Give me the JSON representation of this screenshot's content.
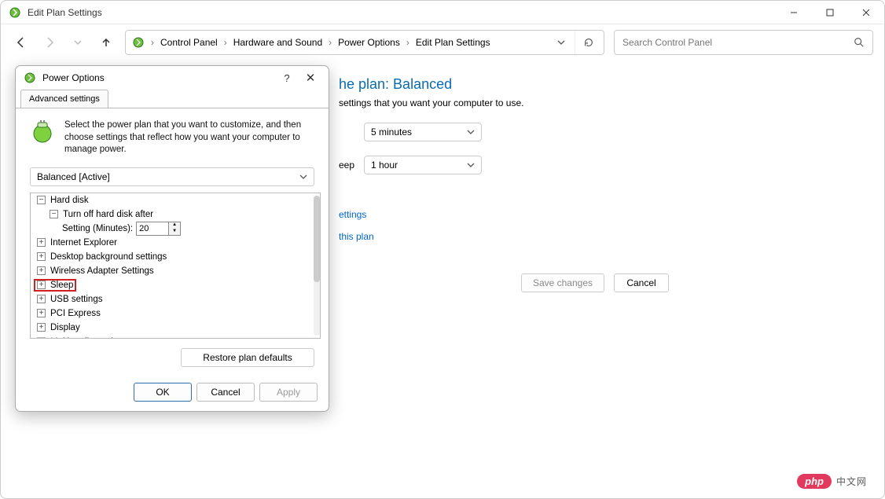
{
  "window": {
    "title": "Edit Plan Settings"
  },
  "breadcrumb": {
    "items": [
      "Control Panel",
      "Hardware and Sound",
      "Power Options",
      "Edit Plan Settings"
    ]
  },
  "search": {
    "placeholder": "Search Control Panel"
  },
  "main": {
    "heading_visible": "he plan: Balanced",
    "subtext_visible": "settings that you want your computer to use.",
    "row1_label_visible": "",
    "row1_value": "5 minutes",
    "row2_label_visible": "eep:",
    "row2_value": "1 hour",
    "link1_visible": "ettings",
    "link2_visible": "this plan",
    "btn_save": "Save changes",
    "btn_cancel": "Cancel"
  },
  "dialog": {
    "title": "Power Options",
    "tab": "Advanced settings",
    "description": "Select the power plan that you want to customize, and then choose settings that reflect how you want your computer to manage power.",
    "plan_selector": "Balanced [Active]",
    "tree": {
      "n0": "Hard disk",
      "n0_0": "Turn off hard disk after",
      "n0_0_lbl": "Setting (Minutes):",
      "n0_0_val": "20",
      "n1": "Internet Explorer",
      "n2": "Desktop background settings",
      "n3": "Wireless Adapter Settings",
      "n4": "Sleep",
      "n5": "USB settings",
      "n6": "PCI Express",
      "n7": "Display",
      "n8": "Multimedia settings"
    },
    "btn_restore": "Restore plan defaults",
    "btn_ok": "OK",
    "btn_cancel": "Cancel",
    "btn_apply": "Apply"
  },
  "watermark": {
    "pill": "php",
    "text": "中文网"
  }
}
